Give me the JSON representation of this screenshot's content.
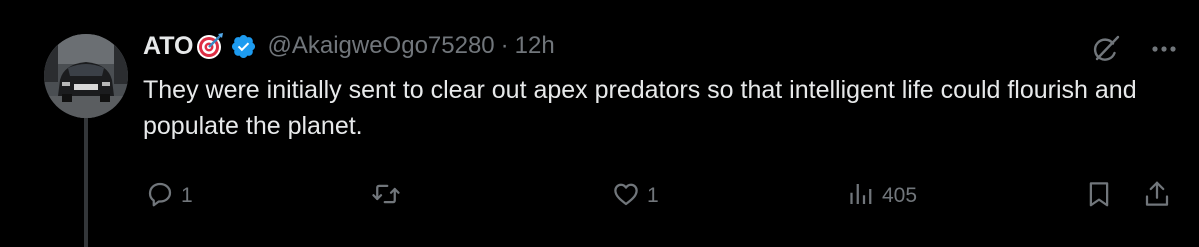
{
  "colors": {
    "background": "#000000",
    "text_primary": "#e7e9ea",
    "text_secondary": "#71767b",
    "verified_blue": "#1d9bf0",
    "thread_line": "#333639"
  },
  "tweet": {
    "author": {
      "display_name": "ATO",
      "display_emoji": "target-emoji",
      "verified_icon": "verified-badge-icon",
      "handle": "@AkaigweOgo75280"
    },
    "separator": "·",
    "time": "12h",
    "text": "They were initially sent to clear out apex predators so that intelligent life could flourish and populate the planet.",
    "top_icons": [
      "grok-icon",
      "more-icon"
    ],
    "actions": {
      "reply": {
        "icon": "reply-icon",
        "count": "1"
      },
      "repost": {
        "icon": "repost-icon",
        "count": ""
      },
      "like": {
        "icon": "like-icon",
        "count": "1"
      },
      "views": {
        "icon": "views-icon",
        "count": "405"
      },
      "bookmark": {
        "icon": "bookmark-icon"
      },
      "share": {
        "icon": "share-icon"
      }
    }
  }
}
